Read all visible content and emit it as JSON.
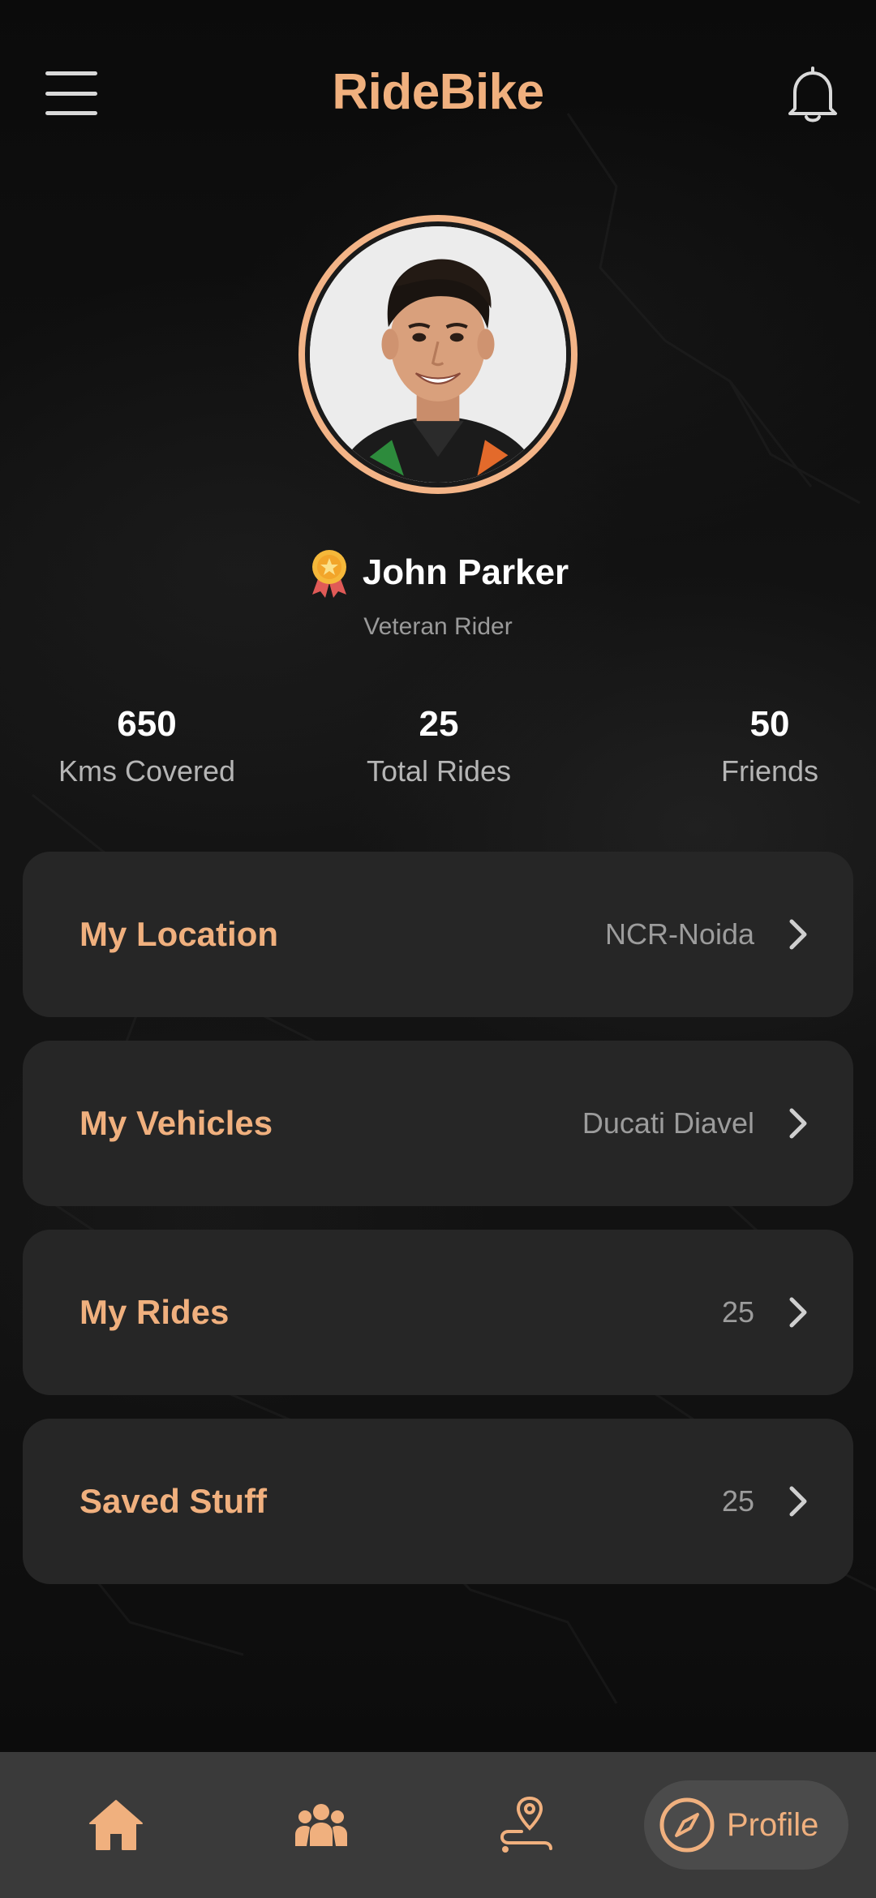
{
  "header": {
    "title": "RideBike",
    "menu_icon": "hamburger-menu-icon",
    "notification_icon": "bell-icon"
  },
  "profile": {
    "name": "John Parker",
    "rank": "Veteran Rider",
    "badge_icon": "medal-icon"
  },
  "stats": [
    {
      "value": "650",
      "label": "Kms Covered"
    },
    {
      "value": "25",
      "label": "Total Rides"
    },
    {
      "value": "50",
      "label": "Friends"
    }
  ],
  "menu": [
    {
      "title": "My Location",
      "value": "NCR-Noida"
    },
    {
      "title": "My Vehicles",
      "value": "Ducati Diavel"
    },
    {
      "title": "My Rides",
      "value": "25"
    },
    {
      "title": "Saved Stuff",
      "value": "25"
    }
  ],
  "bottom_nav": {
    "items": [
      {
        "name": "home",
        "icon": "home-icon",
        "active": false
      },
      {
        "name": "friends",
        "icon": "group-icon",
        "active": false
      },
      {
        "name": "routes",
        "icon": "route-pin-icon",
        "active": false
      }
    ],
    "active": {
      "label": "Profile",
      "icon": "compass-icon"
    }
  },
  "colors": {
    "accent": "#f0b07e",
    "card_bg": "#262626",
    "nav_bg": "#3a3a3a",
    "avatar_ring": "#f3b487"
  }
}
